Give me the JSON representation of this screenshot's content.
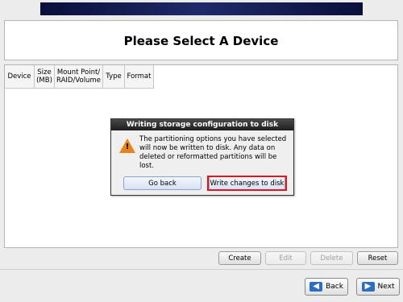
{
  "page": {
    "title": "Please Select A Device"
  },
  "table": {
    "headers": [
      "Device",
      "Size (MB)",
      "Mount Point/ RAID/Volume",
      "Type",
      "Format"
    ]
  },
  "dialog": {
    "title": "Writing storage configuration to disk",
    "message": "The partitioning options you have selected will now be written to disk.  Any data on deleted or reformatted partitions will be lost.",
    "go_back_label": "Go back",
    "write_label": "Write changes to disk"
  },
  "actions": {
    "create": "Create",
    "edit": "Edit",
    "delete": "Delete",
    "reset": "Reset"
  },
  "nav": {
    "back": "Back",
    "next": "Next"
  },
  "colors": {
    "highlight": "#e0141e",
    "arrow": "#2c6fbf",
    "warning": "#e8831a"
  }
}
